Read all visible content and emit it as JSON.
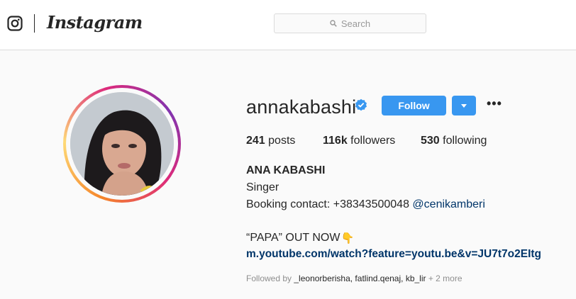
{
  "nav": {
    "wordmark": "Instagram",
    "search_placeholder": "Search"
  },
  "profile": {
    "username": "annakabashi",
    "verified": true,
    "follow_label": "Follow",
    "more_label": "•••",
    "stats": {
      "posts_count": "241",
      "posts_label": "posts",
      "followers_count": "116k",
      "followers_label": "followers",
      "following_count": "530",
      "following_label": "following"
    },
    "full_name": "ANA KABASHI",
    "bio_line1": "Singer",
    "bio_line2_text": "Booking contact: +38343500048 ",
    "bio_line2_mention": "@cenikamberi",
    "bio_line3": "“PAPA” OUT NOW",
    "bio_emoji": "👇",
    "link": "m.youtube.com/watch?feature=youtu.be&v=JU7t7o2EItg",
    "followed_by_prefix": "Followed by ",
    "followed_by_names": "_leonorberisha, fatlind.qenaj, kb_lir",
    "followed_by_more": " + 2 more"
  },
  "colors": {
    "accent": "#3897f0",
    "link": "#003569"
  },
  "icons": [
    "instagram-icon",
    "search-icon",
    "verified-badge-icon",
    "chevron-down-icon",
    "more-icon",
    "pointing-down-icon"
  ]
}
